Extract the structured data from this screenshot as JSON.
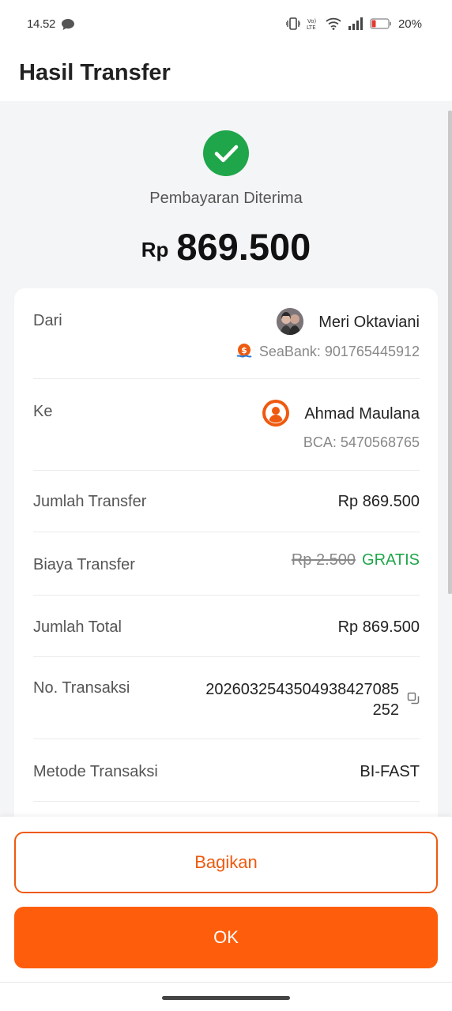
{
  "status_bar": {
    "time": "14.52",
    "battery": "20%",
    "icons": [
      "chat-bubble-icon",
      "vibrate-icon",
      "volte-icon",
      "wifi-icon",
      "signal-icon",
      "battery-icon"
    ]
  },
  "header": {
    "title": "Hasil Transfer"
  },
  "result": {
    "status": "Pembayaran Diterima",
    "currency": "Rp",
    "amount": "869.500",
    "status_color": "#1fa64a"
  },
  "details": {
    "from": {
      "label": "Dari",
      "name": "Meri Oktaviani",
      "account": "SeaBank: 901765445912"
    },
    "to": {
      "label": "Ke",
      "name": "Ahmad Maulana",
      "account": "BCA: 5470568765"
    },
    "transfer_amount": {
      "label": "Jumlah Transfer",
      "value": "Rp 869.500"
    },
    "transfer_fee": {
      "label": "Biaya Transfer",
      "original": "Rp 2.500",
      "value": "GRATIS"
    },
    "total_amount": {
      "label": "Jumlah Total",
      "value": "Rp 869.500"
    },
    "transaction_no": {
      "label": "No. Transaksi",
      "line1": "20260325435049384270​85",
      "line2": "252"
    },
    "method": {
      "label": "Metode Transaksi",
      "value": "BI-FAST"
    }
  },
  "actions": {
    "share_label": "Bagikan",
    "ok_label": "OK"
  },
  "colors": {
    "accent": "#fe5e0c",
    "success": "#1fa64a"
  }
}
